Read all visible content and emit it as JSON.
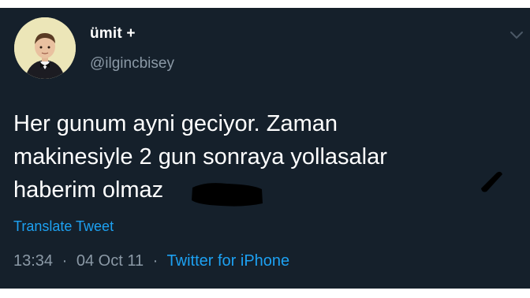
{
  "tweet": {
    "display_name": "ümit +",
    "handle": "@ilgincbisey",
    "text_lines": [
      "Her gunum ayni geciyor. Zaman",
      "makinesiyle 2 gun sonraya yollasalar",
      "haberim olmaz"
    ],
    "translate_label": "Translate Tweet",
    "time": "13:34",
    "separator": "·",
    "date": "04 Oct 11",
    "source": "Twitter for iPhone"
  },
  "icons": {
    "avatar": "avatar-photo",
    "menu": "chevron-down-icon"
  },
  "colors": {
    "background": "#15202b",
    "text": "#ffffff",
    "muted": "#8b99a6",
    "link": "#1da1f2"
  }
}
